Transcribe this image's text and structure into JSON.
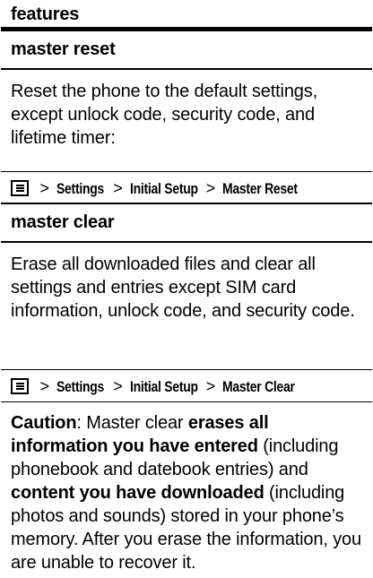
{
  "header": {
    "title": "features"
  },
  "sections": [
    {
      "title": "master reset",
      "description": "Reset the phone to the default settings, except unlock code, security code, and lifetime timer:",
      "path": {
        "sep": ">",
        "items": [
          "Settings",
          "Initial Setup",
          "Master Reset"
        ]
      }
    },
    {
      "title": "master clear",
      "description": "Erase all downloaded files and clear all settings and entries except SIM card information, unlock code, and security code.",
      "path": {
        "sep": ">",
        "items": [
          "Settings",
          "Initial Setup",
          "Master Clear"
        ]
      },
      "caution": {
        "label": "Caution",
        "t1": ": Master clear ",
        "b1": "erases all information you have entered",
        "t2": " (including phonebook and datebook entries) and ",
        "b2": "content you have downloaded",
        "t3": " (including photos and sounds) stored in your phone’s memory. After you erase the information, you are unable to recover it."
      }
    }
  ]
}
